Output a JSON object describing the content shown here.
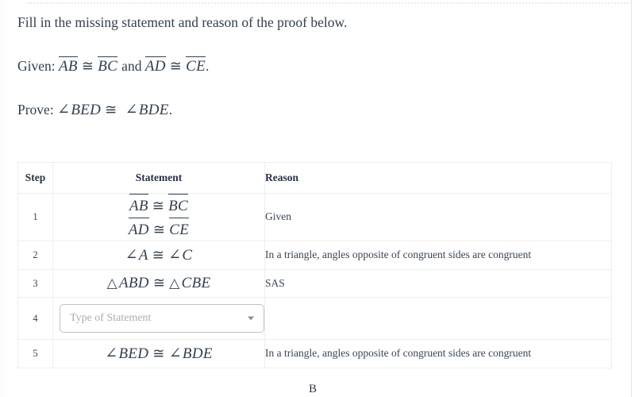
{
  "document": {
    "instruction": "Fill in the missing statement and reason of the proof below.",
    "given": {
      "label": "Given:",
      "seg1a": "AB",
      "cong1": "≅",
      "seg1b": "BC",
      "conjunction": "and",
      "seg2a": "AD",
      "cong2": "≅",
      "seg2b": "CE",
      "period": "."
    },
    "prove": {
      "label": "Prove:",
      "angle_symbol_1": "∠",
      "angle1": "BED",
      "cong": "≅",
      "angle_symbol_2": "∠",
      "angle2": "BDE",
      "period": "."
    }
  },
  "table": {
    "headers": {
      "step": "Step",
      "statement": "Statement",
      "reason": "Reason"
    },
    "rows": [
      {
        "step": "1",
        "statement_lines": [
          {
            "a": "AB",
            "cong": "≅",
            "b": "BC",
            "type": "segment"
          },
          {
            "a": "AD",
            "cong": "≅",
            "b": "CE",
            "type": "segment"
          }
        ],
        "reason": "Given"
      },
      {
        "step": "2",
        "angle_sym_a": "∠",
        "a": "A",
        "cong": "≅",
        "angle_sym_b": "∠",
        "b": "C",
        "reason": "In a triangle, angles opposite of congruent sides are congruent"
      },
      {
        "step": "3",
        "tri_sym_a": "△",
        "a": "ABD",
        "cong": "≅",
        "tri_sym_b": "△",
        "b": "CBE",
        "reason": "SAS"
      },
      {
        "step": "4",
        "select_placeholder": "Type of Statement",
        "select_icon": "chevron-down-icon",
        "reason": ""
      },
      {
        "step": "5",
        "angle_sym_a": "∠",
        "a": "BED",
        "cong": "≅",
        "angle_sym_b": "∠",
        "b": "BDE",
        "reason": "In a triangle, angles opposite of congruent sides are congruent"
      }
    ]
  },
  "figure": {
    "vertex_label_b": "B"
  },
  "colors": {
    "text": "#33404f",
    "muted_text": "#a9aeb3",
    "table_border": "#edeef0",
    "select_border": "#bfc3c7",
    "dotted_rule": "#e9eaec"
  }
}
